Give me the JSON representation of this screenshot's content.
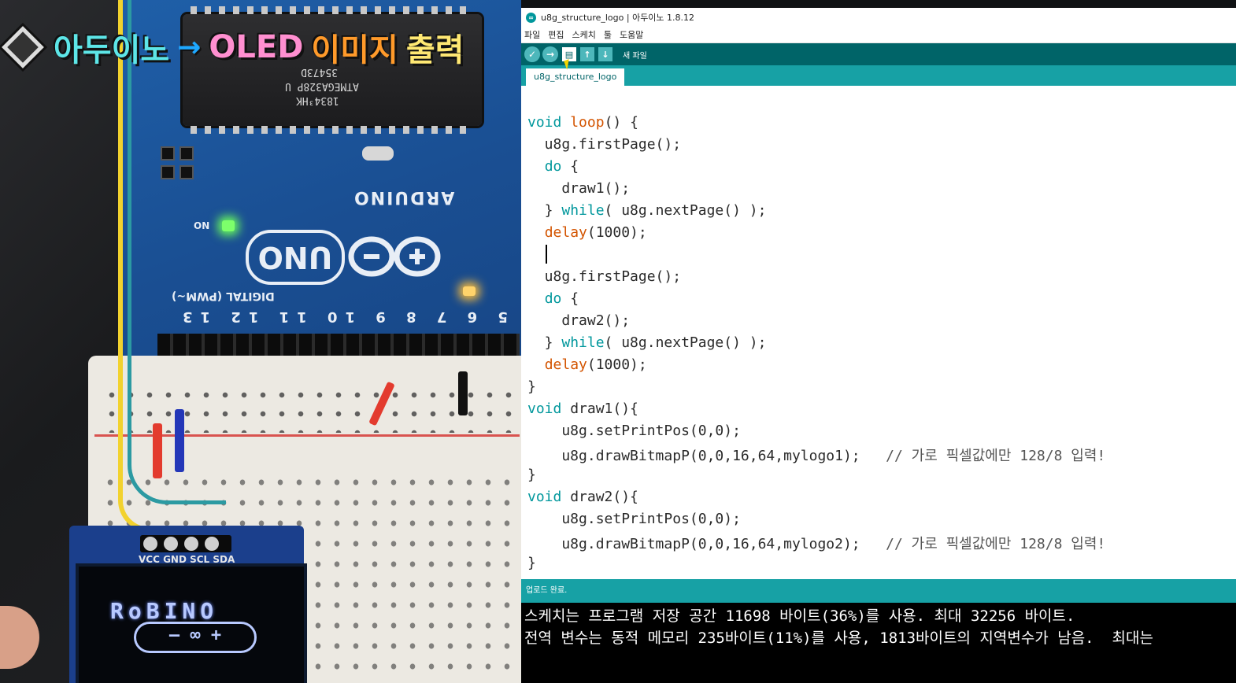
{
  "overlay": {
    "title_part1": "아두이노",
    "arrow": "→",
    "title_part2": "OLED",
    "title_part3": "이미지",
    "title_part4": "출력"
  },
  "photo": {
    "chip_line1": "35473D",
    "chip_line2": "ATMEGA328P U",
    "chip_line3": "1834³HK",
    "board_uno": "UNO",
    "board_arduino": "ARDUINO",
    "board_digital": "DIGITAL (PWM~)",
    "board_on": "ON",
    "oled_pins": "VCC GND SCL SDA",
    "oled_logo": "RoBINO",
    "oled_logo_sub": "— ∞ +"
  },
  "ide": {
    "window_title": "u8g_structure_logo | 아두이노 1.8.12",
    "app_icon": "∞",
    "menu": [
      "파일",
      "편집",
      "스케치",
      "툴",
      "도움말"
    ],
    "toolbar": {
      "verify_icon": "✓",
      "upload_icon": "→",
      "new_icon": "▤",
      "open_icon": "↑",
      "save_icon": "↓",
      "hint": "새 파일"
    },
    "tab": "u8g_structure_logo",
    "code_lines": [
      {
        "text": ""
      },
      {
        "kw": "void",
        "mid": " ",
        "fn": "loop",
        "rest": "() {"
      },
      {
        "pre": "  u8g.firstPage();"
      },
      {
        "kwpre": "  ",
        "kw": "do",
        "rest": " {"
      },
      {
        "pre": "    draw1();"
      },
      {
        "kwpre": "  } ",
        "kw": "while",
        "rest": "( u8g.nextPage() );"
      },
      {
        "kwpre": "  ",
        "fn": "delay",
        "rest": "(1000);"
      },
      {
        "pre": ""
      },
      {
        "pre": "  u8g.firstPage();"
      },
      {
        "kwpre": "  ",
        "kw": "do",
        "rest": " {"
      },
      {
        "pre": "    draw2();"
      },
      {
        "kwpre": "  } ",
        "kw": "while",
        "rest": "( u8g.nextPage() );"
      },
      {
        "kwpre": "  ",
        "fn": "delay",
        "rest": "(1000);"
      },
      {
        "pre": "}"
      },
      {
        "kw": "void",
        "mid": " ",
        "rest": "draw1(){"
      },
      {
        "pre": "    u8g.setPrintPos(0,0);"
      },
      {
        "pre": "    u8g.drawBitmapP(0,0,16,64,mylogo1);",
        "cm": "   // 가로 픽셀값에만 128/8 입력!"
      },
      {
        "pre": "}"
      },
      {
        "kw": "void",
        "mid": " ",
        "rest": "draw2(){"
      },
      {
        "pre": "    u8g.setPrintPos(0,0);"
      },
      {
        "pre": "    u8g.drawBitmapP(0,0,16,64,mylogo2);",
        "cm": "   // 가로 픽셀값에만 128/8 입력!"
      },
      {
        "pre": "}"
      }
    ],
    "status": "업로드 완료.",
    "console": [
      "스케치는 프로그램 저장 공간 11698 바이트(36%)를 사용. 최대 32256 바이트.",
      "전역 변수는 동적 메모리 235바이트(11%)를 사용, 1813바이트의 지역변수가 남음.  최대는"
    ],
    "colors": {
      "toolbar": "#006468",
      "tabbar": "#17a1a5",
      "keyword": "#00979c",
      "function": "#d35400"
    }
  }
}
